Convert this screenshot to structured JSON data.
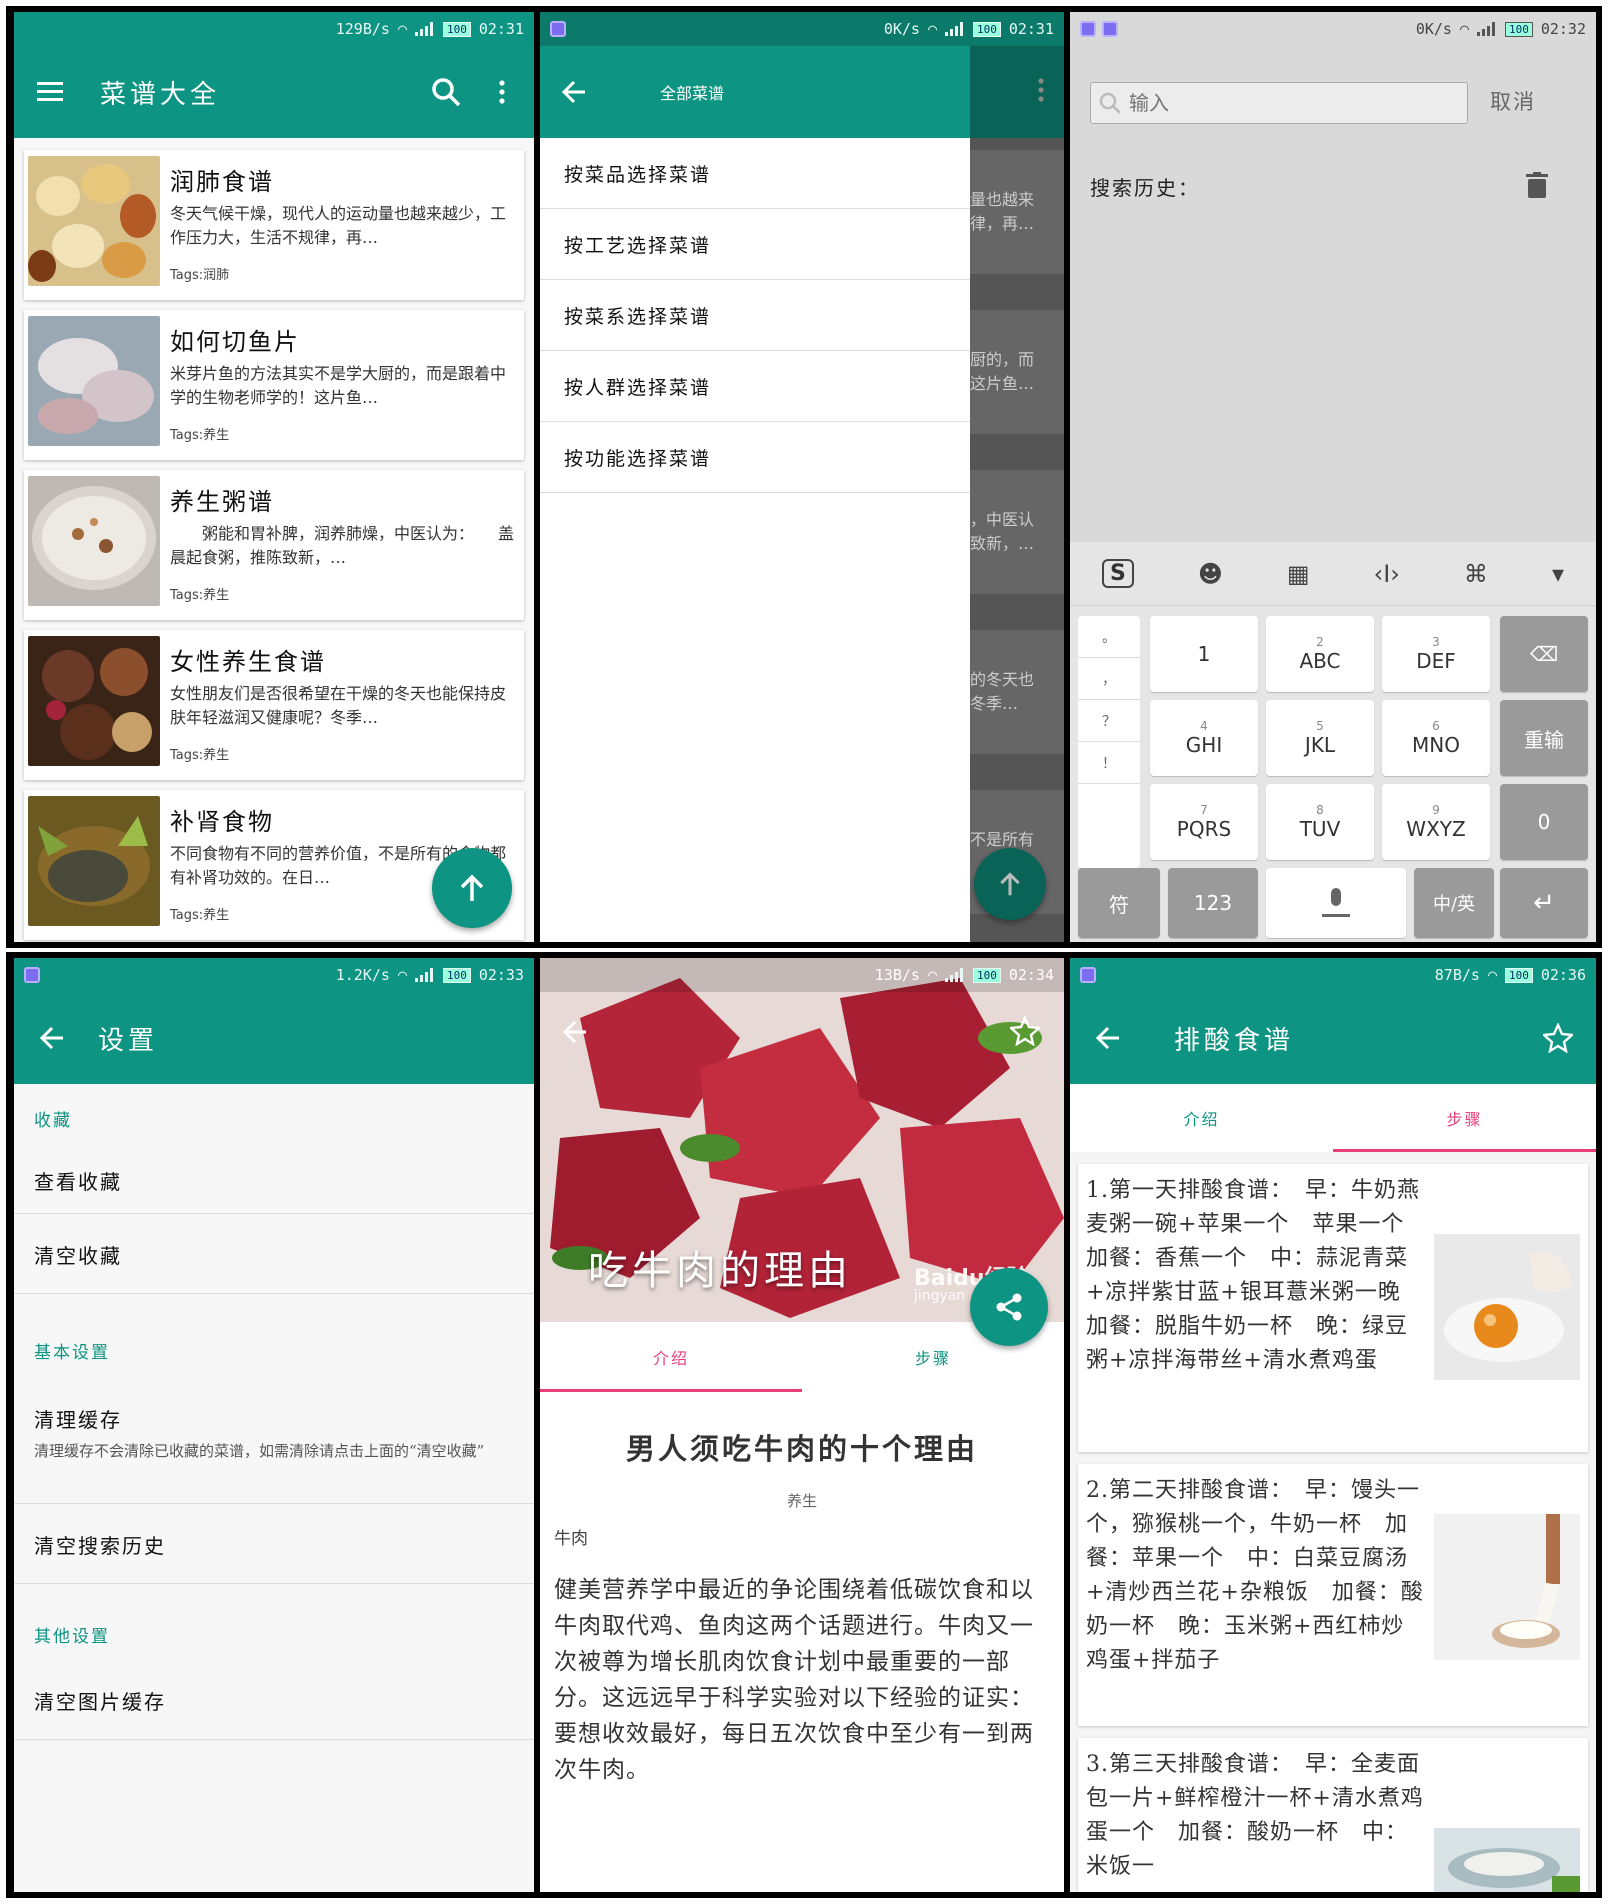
{
  "colors": {
    "primary": "#0d9482",
    "accent_pink": "#e83e7a",
    "frame": "#000000"
  },
  "screen1": {
    "status": {
      "speed": "129B/s",
      "net": "3G",
      "battery": "100",
      "time": "02:31"
    },
    "toolbar": {
      "title": "菜谱大全",
      "menu_icon": "hamburger-icon",
      "search_icon": "search-icon",
      "more_icon": "more-vert-icon"
    },
    "recipes": [
      {
        "title": "润肺食谱",
        "desc": "冬天气候干燥，现代人的运动量也越来越少，工作压力大，生活不规律，再…",
        "tags": "Tags:润肺"
      },
      {
        "title": "如何切鱼片",
        "desc": "米芽片鱼的方法其实不是学大厨的，而是跟着中学的生物老师学的！这片鱼…",
        "tags": "Tags:养生"
      },
      {
        "title": "养生粥谱",
        "desc": "　　粥能和胃补脾，润养肺燥，中医认为：　　盖晨起食粥，推陈致新，…",
        "tags": "Tags:养生"
      },
      {
        "title": "女性养生食谱",
        "desc": "女性朋友们是否很希望在干燥的冬天也能保持皮肤年轻滋润又健康呢？冬季…",
        "tags": "Tags:养生"
      },
      {
        "title": "补肾食物",
        "desc": "不同食物有不同的营养价值，不是所有的食物都有补肾功效的。在日…",
        "tags": "Tags:养生"
      }
    ],
    "fab_icon": "arrow-up-icon"
  },
  "screen2": {
    "status": {
      "speed": "0K/s",
      "net": "2G",
      "battery": "100",
      "time": "02:31"
    },
    "drawer": {
      "title": "全部菜谱",
      "items": [
        "按菜品选择菜谱",
        "按工艺选择菜谱",
        "按菜系选择菜谱",
        "按人群选择菜谱",
        "按功能选择菜谱"
      ]
    },
    "ghost_lines": [
      [
        "量也越来",
        "律，再…"
      ],
      [
        "厨的，而",
        "这片鱼…"
      ],
      [
        "，中医认",
        "致新，…"
      ],
      [
        "的冬天也",
        "冬季…"
      ],
      [
        "不是所有",
        ""
      ]
    ]
  },
  "screen3": {
    "status": {
      "speed": "0K/s",
      "net": "2G",
      "battery": "100",
      "time": "02:32"
    },
    "search_placeholder": "输入",
    "cancel_label": "取消",
    "history_label": "搜索历史：",
    "keyboard": {
      "side_keys": [
        "。",
        "，",
        "？",
        "！"
      ],
      "rows": [
        [
          {
            "num": "",
            "label": "1"
          },
          {
            "num": "2",
            "label": "ABC"
          },
          {
            "num": "3",
            "label": "DEF"
          }
        ],
        [
          {
            "num": "4",
            "label": "GHI"
          },
          {
            "num": "5",
            "label": "JKL"
          },
          {
            "num": "6",
            "label": "MNO"
          }
        ],
        [
          {
            "num": "7",
            "label": "PQRS"
          },
          {
            "num": "8",
            "label": "TUV"
          },
          {
            "num": "9",
            "label": "WXYZ"
          }
        ]
      ],
      "right_keys": [
        "⌫",
        "重输",
        "0"
      ],
      "bottom": {
        "sym": "符",
        "num": "123",
        "lang": "中/英",
        "enter": "↵"
      }
    }
  },
  "screen4": {
    "status": {
      "speed": "1.2K/s",
      "net": "2G",
      "battery": "100",
      "time": "02:33"
    },
    "title": "设置",
    "sections": {
      "fav": "收藏",
      "basic": "基本设置",
      "other": "其他设置"
    },
    "items": {
      "view_fav": "查看收藏",
      "clear_fav": "清空收藏",
      "clear_cache": "清理缓存",
      "clear_cache_sub": "清理缓存不会清除已收藏的菜谱，如需清除请点击上面的“清空收藏”",
      "clear_history": "清空搜索历史",
      "clear_img": "清空图片缓存"
    }
  },
  "screen5": {
    "status": {
      "speed": "13B/s",
      "net": "2G",
      "battery": "100",
      "time": "02:34"
    },
    "hero_title": "吃牛肉的理由",
    "watermark": "Baidu经验",
    "watermark_sub": "jingyan",
    "tabs": [
      "介绍",
      "步骤"
    ],
    "article_title": "男人须吃牛肉的十个理由",
    "tag": "养生",
    "ingredient": "牛肉",
    "body": "健美营养学中最近的争论围绕着低碳饮食和以牛肉取代鸡、鱼肉这两个话题进行。牛肉又一次被尊为增长肌肉饮食计划中最重要的一部分。这远远早于科学实验对以下经验的证实：要想收效最好，每日五次饮食中至少有一到两次牛肉。"
  },
  "screen6": {
    "status": {
      "speed": "87B/s",
      "net": "",
      "battery": "100",
      "time": "02:36"
    },
    "title": "排酸食谱",
    "tabs": [
      "介绍",
      "步骤"
    ],
    "steps": [
      "1.第一天排酸食谱：　早：牛奶燕麦粥一碗+苹果一个　苹果一个　加餐：香蕉一个　中：蒜泥青菜+凉拌紫甘蓝+银耳薏米粥一晚　加餐：脱脂牛奶一杯　晚：绿豆粥+凉拌海带丝+清水煮鸡蛋",
      "2.第二天排酸食谱：　早：馒头一个，猕猴桃一个，牛奶一杯　加餐：苹果一个　中：白菜豆腐汤+清炒西兰花+杂粮饭　加餐：酸奶一杯　晚：玉米粥+西红柿炒鸡蛋+拌茄子",
      "3.第三天排酸食谱：　早：全麦面包一片+鲜榨橙汁一杯+清水煮鸡蛋一个　加餐：酸奶一杯　中：米饭一"
    ]
  }
}
